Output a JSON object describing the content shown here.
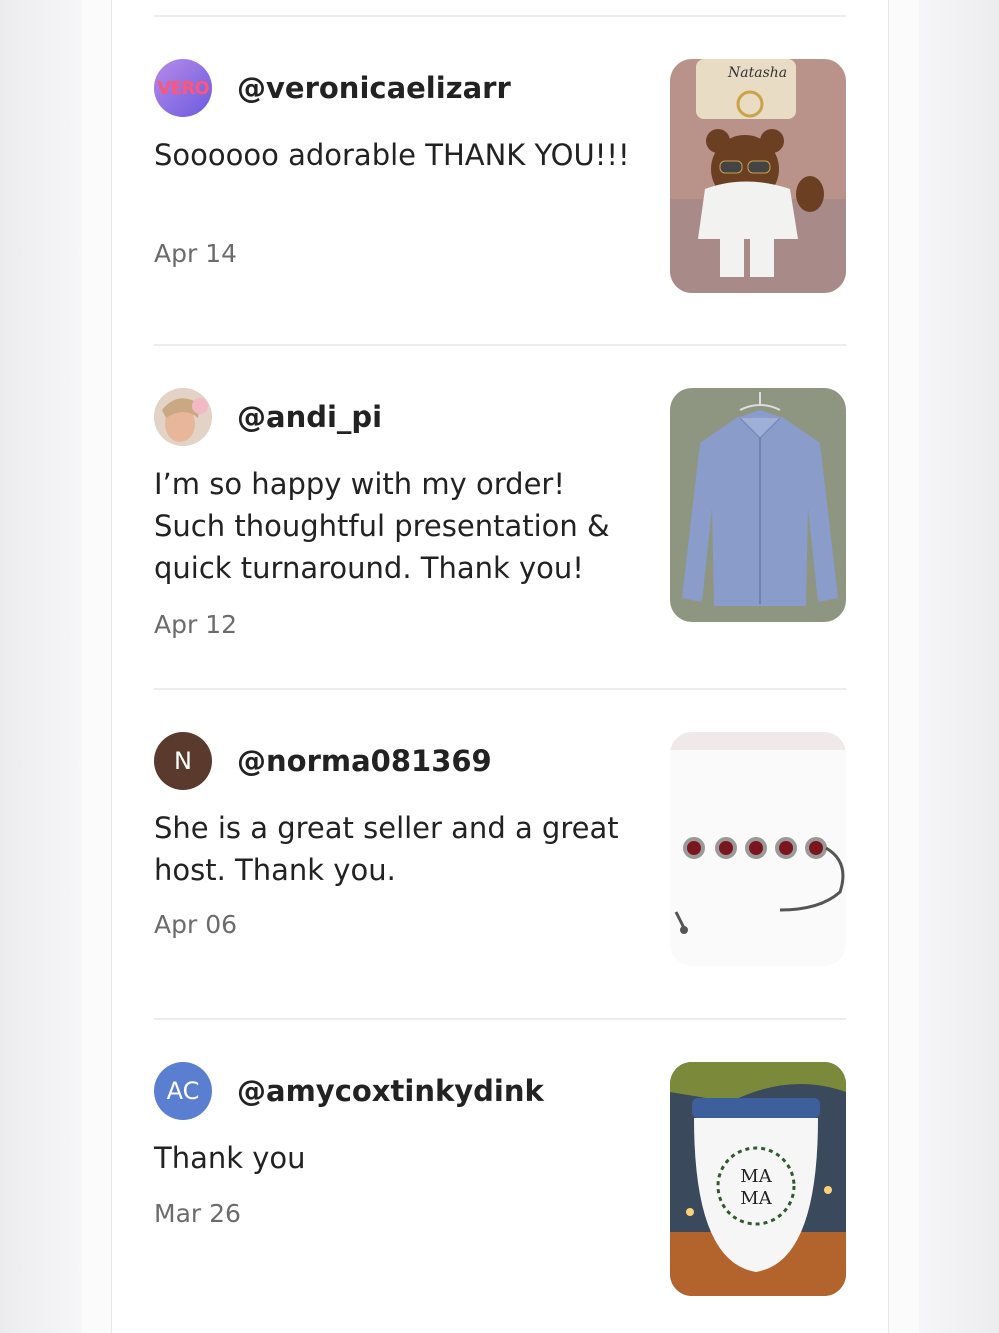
{
  "reviews": [
    {
      "username": "@veronicaelizarr",
      "text": "Soooooo adorable THANK YOU!!!",
      "date": "Apr 14",
      "avatar_text": "VERO",
      "item_label": "Natasha"
    },
    {
      "username": "@andi_pi",
      "text": "I’m so happy with my order! Such thoughtful presentation & quick turnaround. Thank you!",
      "date": "Apr 12"
    },
    {
      "username": "@norma081369",
      "text": "She is a great seller and a great host. Thank you.",
      "date": "Apr 06",
      "avatar_initials": "N"
    },
    {
      "username": "@amycoxtinkydink",
      "text": "Thank you",
      "date": "Mar 26",
      "avatar_initials": "AC",
      "item_label_line1": "MA",
      "item_label_line2": "MA"
    }
  ],
  "colors": {
    "avatar_norma": "#5b3a2e",
    "avatar_amy": "#5b7fd0"
  }
}
